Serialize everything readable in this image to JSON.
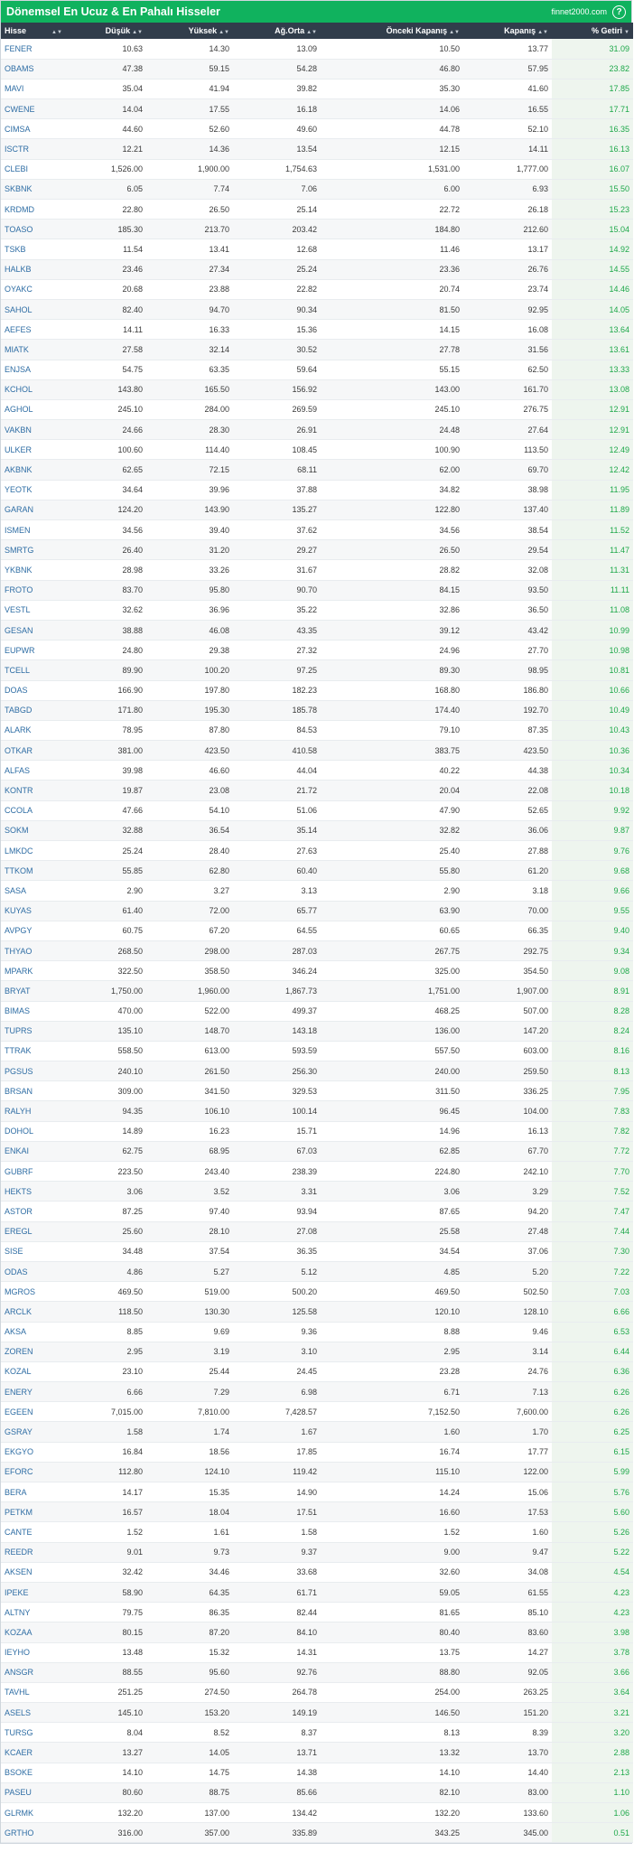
{
  "header": {
    "title": "Dönemsel En Ucuz & En Pahalı Hisseler",
    "brand": "finnet2000.com",
    "help_icon": "?"
  },
  "columns": [
    "Hisse",
    "Düşük",
    "Yüksek",
    "Ağ.Orta",
    "Önceki Kapanış",
    "Kapanış",
    "% Getiri"
  ],
  "rows": [
    [
      "FENER",
      "10.63",
      "14.30",
      "13.09",
      "10.50",
      "13.77",
      "31.09"
    ],
    [
      "OBAMS",
      "47.38",
      "59.15",
      "54.28",
      "46.80",
      "57.95",
      "23.82"
    ],
    [
      "MAVI",
      "35.04",
      "41.94",
      "39.82",
      "35.30",
      "41.60",
      "17.85"
    ],
    [
      "CWENE",
      "14.04",
      "17.55",
      "16.18",
      "14.06",
      "16.55",
      "17.71"
    ],
    [
      "CIMSA",
      "44.60",
      "52.60",
      "49.60",
      "44.78",
      "52.10",
      "16.35"
    ],
    [
      "ISCTR",
      "12.21",
      "14.36",
      "13.54",
      "12.15",
      "14.11",
      "16.13"
    ],
    [
      "CLEBI",
      "1,526.00",
      "1,900.00",
      "1,754.63",
      "1,531.00",
      "1,777.00",
      "16.07"
    ],
    [
      "SKBNK",
      "6.05",
      "7.74",
      "7.06",
      "6.00",
      "6.93",
      "15.50"
    ],
    [
      "KRDMD",
      "22.80",
      "26.50",
      "25.14",
      "22.72",
      "26.18",
      "15.23"
    ],
    [
      "TOASO",
      "185.30",
      "213.70",
      "203.42",
      "184.80",
      "212.60",
      "15.04"
    ],
    [
      "TSKB",
      "11.54",
      "13.41",
      "12.68",
      "11.46",
      "13.17",
      "14.92"
    ],
    [
      "HALKB",
      "23.46",
      "27.34",
      "25.24",
      "23.36",
      "26.76",
      "14.55"
    ],
    [
      "OYAKC",
      "20.68",
      "23.88",
      "22.82",
      "20.74",
      "23.74",
      "14.46"
    ],
    [
      "SAHOL",
      "82.40",
      "94.70",
      "90.34",
      "81.50",
      "92.95",
      "14.05"
    ],
    [
      "AEFES",
      "14.11",
      "16.33",
      "15.36",
      "14.15",
      "16.08",
      "13.64"
    ],
    [
      "MIATK",
      "27.58",
      "32.14",
      "30.52",
      "27.78",
      "31.56",
      "13.61"
    ],
    [
      "ENJSA",
      "54.75",
      "63.35",
      "59.64",
      "55.15",
      "62.50",
      "13.33"
    ],
    [
      "KCHOL",
      "143.80",
      "165.50",
      "156.92",
      "143.00",
      "161.70",
      "13.08"
    ],
    [
      "AGHOL",
      "245.10",
      "284.00",
      "269.59",
      "245.10",
      "276.75",
      "12.91"
    ],
    [
      "VAKBN",
      "24.66",
      "28.30",
      "26.91",
      "24.48",
      "27.64",
      "12.91"
    ],
    [
      "ULKER",
      "100.60",
      "114.40",
      "108.45",
      "100.90",
      "113.50",
      "12.49"
    ],
    [
      "AKBNK",
      "62.65",
      "72.15",
      "68.11",
      "62.00",
      "69.70",
      "12.42"
    ],
    [
      "YEOTK",
      "34.64",
      "39.96",
      "37.88",
      "34.82",
      "38.98",
      "11.95"
    ],
    [
      "GARAN",
      "124.20",
      "143.90",
      "135.27",
      "122.80",
      "137.40",
      "11.89"
    ],
    [
      "ISMEN",
      "34.56",
      "39.40",
      "37.62",
      "34.56",
      "38.54",
      "11.52"
    ],
    [
      "SMRTG",
      "26.40",
      "31.20",
      "29.27",
      "26.50",
      "29.54",
      "11.47"
    ],
    [
      "YKBNK",
      "28.98",
      "33.26",
      "31.67",
      "28.82",
      "32.08",
      "11.31"
    ],
    [
      "FROTO",
      "83.70",
      "95.80",
      "90.70",
      "84.15",
      "93.50",
      "11.11"
    ],
    [
      "VESTL",
      "32.62",
      "36.96",
      "35.22",
      "32.86",
      "36.50",
      "11.08"
    ],
    [
      "GESAN",
      "38.88",
      "46.08",
      "43.35",
      "39.12",
      "43.42",
      "10.99"
    ],
    [
      "EUPWR",
      "24.80",
      "29.38",
      "27.32",
      "24.96",
      "27.70",
      "10.98"
    ],
    [
      "TCELL",
      "89.90",
      "100.20",
      "97.25",
      "89.30",
      "98.95",
      "10.81"
    ],
    [
      "DOAS",
      "166.90",
      "197.80",
      "182.23",
      "168.80",
      "186.80",
      "10.66"
    ],
    [
      "TABGD",
      "171.80",
      "195.30",
      "185.78",
      "174.40",
      "192.70",
      "10.49"
    ],
    [
      "ALARK",
      "78.95",
      "87.80",
      "84.53",
      "79.10",
      "87.35",
      "10.43"
    ],
    [
      "OTKAR",
      "381.00",
      "423.50",
      "410.58",
      "383.75",
      "423.50",
      "10.36"
    ],
    [
      "ALFAS",
      "39.98",
      "46.60",
      "44.04",
      "40.22",
      "44.38",
      "10.34"
    ],
    [
      "KONTR",
      "19.87",
      "23.08",
      "21.72",
      "20.04",
      "22.08",
      "10.18"
    ],
    [
      "CCOLA",
      "47.66",
      "54.10",
      "51.06",
      "47.90",
      "52.65",
      "9.92"
    ],
    [
      "SOKM",
      "32.88",
      "36.54",
      "35.14",
      "32.82",
      "36.06",
      "9.87"
    ],
    [
      "LMKDC",
      "25.24",
      "28.40",
      "27.63",
      "25.40",
      "27.88",
      "9.76"
    ],
    [
      "TTKOM",
      "55.85",
      "62.80",
      "60.40",
      "55.80",
      "61.20",
      "9.68"
    ],
    [
      "SASA",
      "2.90",
      "3.27",
      "3.13",
      "2.90",
      "3.18",
      "9.66"
    ],
    [
      "KUYAS",
      "61.40",
      "72.00",
      "65.77",
      "63.90",
      "70.00",
      "9.55"
    ],
    [
      "AVPGY",
      "60.75",
      "67.20",
      "64.55",
      "60.65",
      "66.35",
      "9.40"
    ],
    [
      "THYAO",
      "268.50",
      "298.00",
      "287.03",
      "267.75",
      "292.75",
      "9.34"
    ],
    [
      "MPARK",
      "322.50",
      "358.50",
      "346.24",
      "325.00",
      "354.50",
      "9.08"
    ],
    [
      "BRYAT",
      "1,750.00",
      "1,960.00",
      "1,867.73",
      "1,751.00",
      "1,907.00",
      "8.91"
    ],
    [
      "BIMAS",
      "470.00",
      "522.00",
      "499.37",
      "468.25",
      "507.00",
      "8.28"
    ],
    [
      "TUPRS",
      "135.10",
      "148.70",
      "143.18",
      "136.00",
      "147.20",
      "8.24"
    ],
    [
      "TTRAK",
      "558.50",
      "613.00",
      "593.59",
      "557.50",
      "603.00",
      "8.16"
    ],
    [
      "PGSUS",
      "240.10",
      "261.50",
      "256.30",
      "240.00",
      "259.50",
      "8.13"
    ],
    [
      "BRSAN",
      "309.00",
      "341.50",
      "329.53",
      "311.50",
      "336.25",
      "7.95"
    ],
    [
      "RALYH",
      "94.35",
      "106.10",
      "100.14",
      "96.45",
      "104.00",
      "7.83"
    ],
    [
      "DOHOL",
      "14.89",
      "16.23",
      "15.71",
      "14.96",
      "16.13",
      "7.82"
    ],
    [
      "ENKAI",
      "62.75",
      "68.95",
      "67.03",
      "62.85",
      "67.70",
      "7.72"
    ],
    [
      "GUBRF",
      "223.50",
      "243.40",
      "238.39",
      "224.80",
      "242.10",
      "7.70"
    ],
    [
      "HEKTS",
      "3.06",
      "3.52",
      "3.31",
      "3.06",
      "3.29",
      "7.52"
    ],
    [
      "ASTOR",
      "87.25",
      "97.40",
      "93.94",
      "87.65",
      "94.20",
      "7.47"
    ],
    [
      "EREGL",
      "25.60",
      "28.10",
      "27.08",
      "25.58",
      "27.48",
      "7.44"
    ],
    [
      "SISE",
      "34.48",
      "37.54",
      "36.35",
      "34.54",
      "37.06",
      "7.30"
    ],
    [
      "ODAS",
      "4.86",
      "5.27",
      "5.12",
      "4.85",
      "5.20",
      "7.22"
    ],
    [
      "MGROS",
      "469.50",
      "519.00",
      "500.20",
      "469.50",
      "502.50",
      "7.03"
    ],
    [
      "ARCLK",
      "118.50",
      "130.30",
      "125.58",
      "120.10",
      "128.10",
      "6.66"
    ],
    [
      "AKSA",
      "8.85",
      "9.69",
      "9.36",
      "8.88",
      "9.46",
      "6.53"
    ],
    [
      "ZOREN",
      "2.95",
      "3.19",
      "3.10",
      "2.95",
      "3.14",
      "6.44"
    ],
    [
      "KOZAL",
      "23.10",
      "25.44",
      "24.45",
      "23.28",
      "24.76",
      "6.36"
    ],
    [
      "ENERY",
      "6.66",
      "7.29",
      "6.98",
      "6.71",
      "7.13",
      "6.26"
    ],
    [
      "EGEEN",
      "7,015.00",
      "7,810.00",
      "7,428.57",
      "7,152.50",
      "7,600.00",
      "6.26"
    ],
    [
      "GSRAY",
      "1.58",
      "1.74",
      "1.67",
      "1.60",
      "1.70",
      "6.25"
    ],
    [
      "EKGYO",
      "16.84",
      "18.56",
      "17.85",
      "16.74",
      "17.77",
      "6.15"
    ],
    [
      "EFORC",
      "112.80",
      "124.10",
      "119.42",
      "115.10",
      "122.00",
      "5.99"
    ],
    [
      "BERA",
      "14.17",
      "15.35",
      "14.90",
      "14.24",
      "15.06",
      "5.76"
    ],
    [
      "PETKM",
      "16.57",
      "18.04",
      "17.51",
      "16.60",
      "17.53",
      "5.60"
    ],
    [
      "CANTE",
      "1.52",
      "1.61",
      "1.58",
      "1.52",
      "1.60",
      "5.26"
    ],
    [
      "REEDR",
      "9.01",
      "9.73",
      "9.37",
      "9.00",
      "9.47",
      "5.22"
    ],
    [
      "AKSEN",
      "32.42",
      "34.46",
      "33.68",
      "32.60",
      "34.08",
      "4.54"
    ],
    [
      "IPEKE",
      "58.90",
      "64.35",
      "61.71",
      "59.05",
      "61.55",
      "4.23"
    ],
    [
      "ALTNY",
      "79.75",
      "86.35",
      "82.44",
      "81.65",
      "85.10",
      "4.23"
    ],
    [
      "KOZAA",
      "80.15",
      "87.20",
      "84.10",
      "80.40",
      "83.60",
      "3.98"
    ],
    [
      "IEYHO",
      "13.48",
      "15.32",
      "14.31",
      "13.75",
      "14.27",
      "3.78"
    ],
    [
      "ANSGR",
      "88.55",
      "95.60",
      "92.76",
      "88.80",
      "92.05",
      "3.66"
    ],
    [
      "TAVHL",
      "251.25",
      "274.50",
      "264.78",
      "254.00",
      "263.25",
      "3.64"
    ],
    [
      "ASELS",
      "145.10",
      "153.20",
      "149.19",
      "146.50",
      "151.20",
      "3.21"
    ],
    [
      "TURSG",
      "8.04",
      "8.52",
      "8.37",
      "8.13",
      "8.39",
      "3.20"
    ],
    [
      "KCAER",
      "13.27",
      "14.05",
      "13.71",
      "13.32",
      "13.70",
      "2.88"
    ],
    [
      "BSOKE",
      "14.10",
      "14.75",
      "14.38",
      "14.10",
      "14.40",
      "2.13"
    ],
    [
      "PASEU",
      "80.60",
      "88.75",
      "85.66",
      "82.10",
      "83.00",
      "1.10"
    ],
    [
      "GLRMK",
      "132.20",
      "137.00",
      "134.42",
      "132.20",
      "133.60",
      "1.06"
    ],
    [
      "GRTHO",
      "316.00",
      "357.00",
      "335.89",
      "343.25",
      "345.00",
      "0.51"
    ]
  ]
}
